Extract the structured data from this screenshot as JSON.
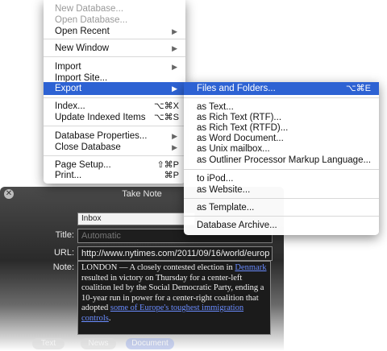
{
  "hud": {
    "title": "Take Note",
    "close_glyph": "✕",
    "group_value": "Inbox",
    "title_label": "Title:",
    "title_placeholder": "Automatic",
    "url_label": "URL:",
    "url_value": "http://www.nytimes.com/2011/09/16/world/europ",
    "note_label": "Note:",
    "note": {
      "t1": "LONDON — A closely contested election in ",
      "link1": "Denmark",
      "t2": " resulted in victory on Thursday for a center-left coalition led by the Social Democratic Party, ending a 10-year run in power for a center-right coalition that adopted ",
      "link2": "some of Europe's toughest immigration controls",
      "t3": "."
    },
    "buttons": [
      "Text",
      "News",
      "Document"
    ]
  },
  "menu": {
    "items": [
      {
        "label": "New Database...",
        "disabled": true
      },
      {
        "label": "Open Database...",
        "disabled": true
      },
      {
        "label": "Open Recent",
        "submenu": true
      },
      {
        "label": "New Window",
        "submenu": true
      },
      {
        "label": "Import",
        "submenu": true
      },
      {
        "label": "Import Site..."
      },
      {
        "label": "Export",
        "submenu": true,
        "selected": true
      },
      {
        "label": "Index...",
        "shortcut": "⌥⌘X"
      },
      {
        "label": "Update Indexed Items",
        "shortcut": "⌥⌘S"
      },
      {
        "label": "Database Properties...",
        "submenu": true
      },
      {
        "label": "Close Database",
        "submenu": true
      },
      {
        "label": "Page Setup...",
        "shortcut": "⇧⌘P"
      },
      {
        "label": "Print...",
        "shortcut": "⌘P"
      }
    ]
  },
  "submenu": {
    "items": [
      {
        "label": "Files and Folders...",
        "shortcut": "⌥⌘E",
        "selected": true
      },
      {
        "label": "as Text..."
      },
      {
        "label": "as Rich Text (RTF)..."
      },
      {
        "label": "as Rich Text (RTFD)..."
      },
      {
        "label": "as Word Document..."
      },
      {
        "label": "as Unix mailbox..."
      },
      {
        "label": "as Outliner Processor Markup Language..."
      },
      {
        "label": "to iPod..."
      },
      {
        "label": "as Website..."
      },
      {
        "label": "as Template..."
      },
      {
        "label": "Database Archive..."
      }
    ]
  },
  "colors": {
    "selection": "#2d62d3",
    "link": "#6a8cff"
  }
}
